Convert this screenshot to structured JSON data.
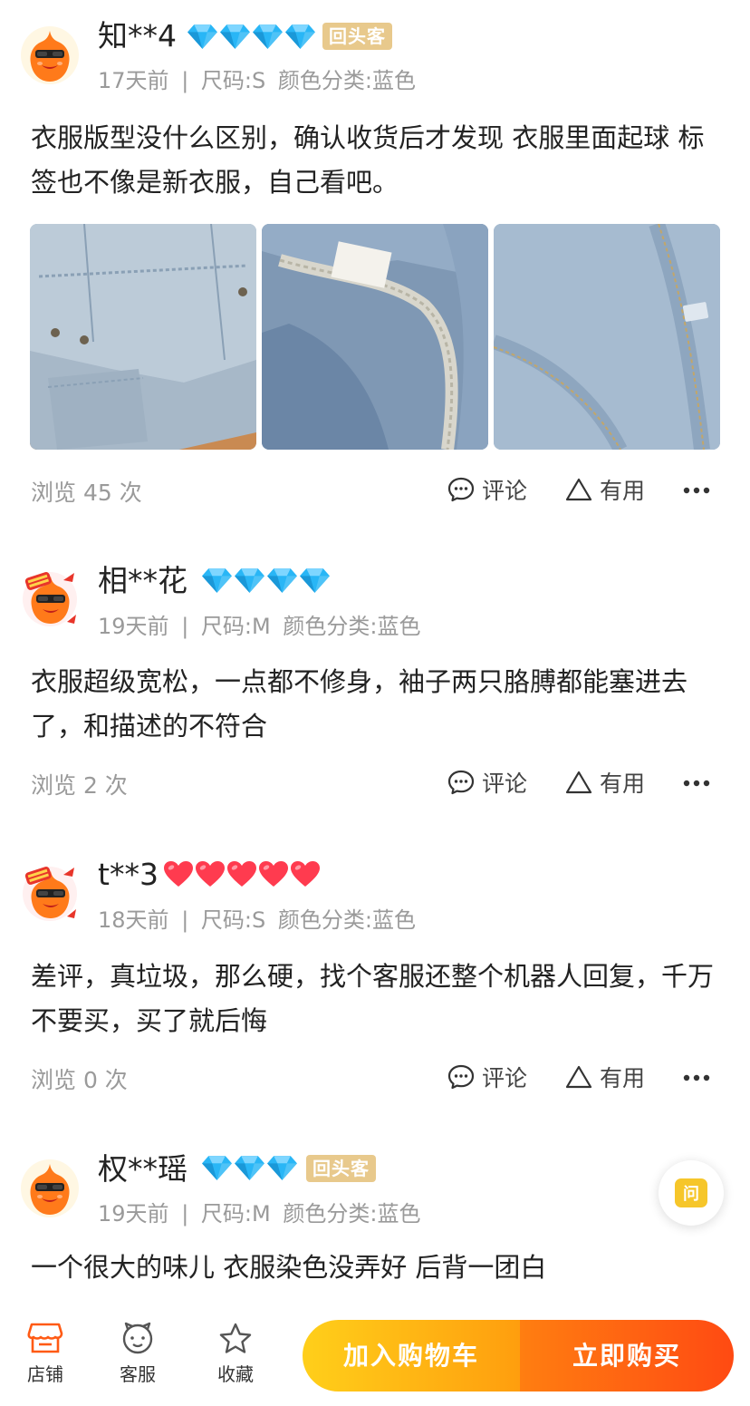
{
  "reviews": [
    {
      "username": "知**4",
      "level_icon": "diamond-icon",
      "level_count": 4,
      "tag": "回头客",
      "days_ago": "17天前",
      "size": "尺码:S",
      "color_category": "颜色分类:蓝色",
      "content": "衣服版型没什么区别，确认收货后才发现 衣服里面起球 标签也不像是新衣服，自己看吧。",
      "photo_count": 3,
      "views": "浏览 45 次",
      "comment_label": "评论",
      "useful_label": "有用"
    },
    {
      "username": "相**花",
      "level_icon": "diamond-icon",
      "level_count": 4,
      "tag": "",
      "days_ago": "19天前",
      "size": "尺码:M",
      "color_category": "颜色分类:蓝色",
      "content": "衣服超级宽松，一点都不修身，袖子两只胳膊都能塞进去了，和描述的不符合",
      "views": "浏览 2 次",
      "comment_label": "评论",
      "useful_label": "有用"
    },
    {
      "username": "t**3",
      "level_icon": "heart-icon",
      "level_count": 5,
      "tag": "",
      "days_ago": "18天前",
      "size": "尺码:S",
      "color_category": "颜色分类:蓝色",
      "content": "差评，真垃圾，那么硬，找个客服还整个机器人回复，千万不要买，买了就后悔",
      "views": "浏览 0 次",
      "comment_label": "评论",
      "useful_label": "有用"
    },
    {
      "username": "权**瑶",
      "level_icon": "diamond-icon",
      "level_count": 3,
      "tag": "回头客",
      "days_ago": "19天前",
      "size": "尺码:M",
      "color_category": "颜色分类:蓝色",
      "content": "一个很大的味儿 衣服染色没弄好 后背一团白"
    }
  ],
  "separator": "|",
  "fab_label": "问",
  "bottom_bar": {
    "shop": "店铺",
    "service": "客服",
    "favorite": "收藏",
    "add_to_cart": "加入购物车",
    "buy_now": "立即购买"
  },
  "colors": {
    "tag_bg": "#e8c98c",
    "diamond": "#29b6f6",
    "heart": "#ff3b4f",
    "cart_gradient": [
      "#ffcf1a",
      "#ff9e0e"
    ],
    "buy_gradient": [
      "#ff7e11",
      "#ff4a12"
    ],
    "fab_icon": "#f6c62a"
  }
}
